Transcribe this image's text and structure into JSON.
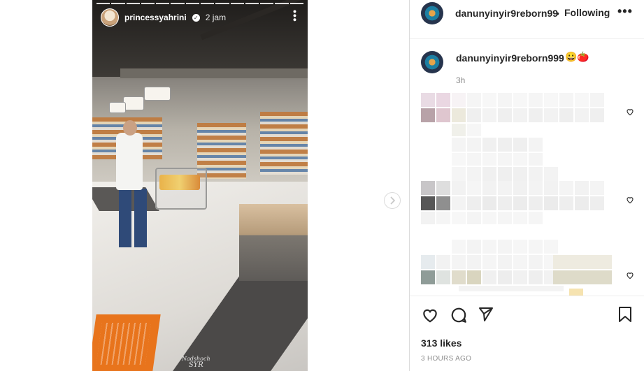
{
  "story": {
    "username": "princessyahrini",
    "time": "2 jam",
    "watermark_line1": "Nadshoch",
    "watermark_line2": "SYR",
    "progress_segments": 14
  },
  "panel": {
    "header": {
      "username": "danunyinyir9reborn99",
      "dot": "•",
      "follow_label": "Following",
      "more_label": "•••"
    },
    "caption": {
      "username": "danunyinyir9reborn999",
      "emojis": "😀🍅",
      "time": "3h"
    },
    "actions": {
      "like": "heart-icon",
      "comment": "comment-icon",
      "share": "share-icon",
      "save": "bookmark-icon"
    },
    "likes": "313 likes",
    "timestamp": "3 HOURS AGO"
  },
  "colors": {
    "text": "#262626",
    "muted": "#8e8e8e",
    "border": "#dbdbdb"
  }
}
